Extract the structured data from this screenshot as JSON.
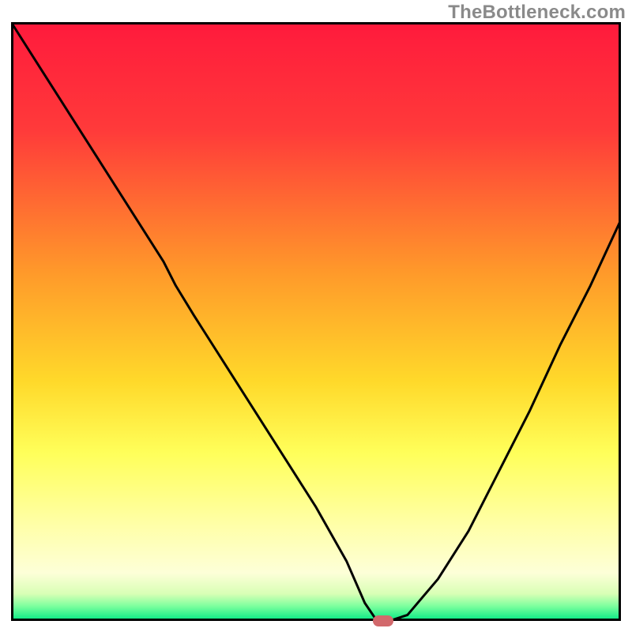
{
  "attribution": "TheBottleneck.com",
  "colors": {
    "curve": "#000000",
    "marker": "#d2696c",
    "frame": "#000000",
    "gradient_stops": [
      {
        "pct": 0,
        "color": "#ff1a3c"
      },
      {
        "pct": 18,
        "color": "#ff3a3a"
      },
      {
        "pct": 42,
        "color": "#ff9a2a"
      },
      {
        "pct": 60,
        "color": "#ffd92a"
      },
      {
        "pct": 72,
        "color": "#ffff5a"
      },
      {
        "pct": 84,
        "color": "#ffffa8"
      },
      {
        "pct": 92,
        "color": "#fdffd8"
      },
      {
        "pct": 95.5,
        "color": "#d8ffb5"
      },
      {
        "pct": 97.5,
        "color": "#7eff9e"
      },
      {
        "pct": 100,
        "color": "#00e884"
      }
    ]
  },
  "chart_data": {
    "type": "line",
    "title": "",
    "xlabel": "",
    "ylabel": "",
    "xlim": [
      0,
      100
    ],
    "ylim": [
      0,
      100
    ],
    "grid": false,
    "legend": false,
    "series": [
      {
        "name": "bottleneck-curve",
        "x": [
          0,
          5,
          10,
          15,
          20,
          25,
          27,
          30,
          35,
          40,
          45,
          50,
          55,
          58,
          60,
          62,
          65,
          70,
          75,
          80,
          85,
          90,
          95,
          100
        ],
        "y": [
          100,
          92,
          84,
          76,
          68,
          60,
          56,
          51,
          43,
          35,
          27,
          19,
          10,
          3,
          0,
          0,
          1,
          7,
          15,
          25,
          35,
          46,
          56,
          67
        ]
      }
    ],
    "marker": {
      "x": 61,
      "y": 0
    }
  }
}
